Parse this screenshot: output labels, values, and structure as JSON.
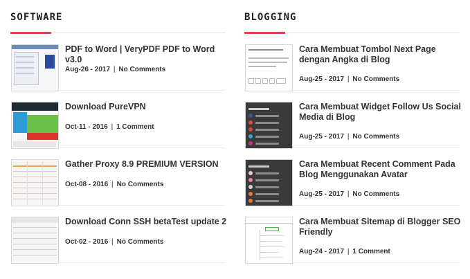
{
  "sections": {
    "software": {
      "title": "SOFTWARE",
      "posts": [
        {
          "title": "PDF to Word | VeryPDF PDF to Word v3.0",
          "date": "Aug-26 - 2017",
          "comments": "No Comments"
        },
        {
          "title": "Download PureVPN",
          "date": "Oct-11 - 2016",
          "comments": "1 Comment"
        },
        {
          "title": "Gather Proxy 8.9 PREMIUM VERSION",
          "date": "Oct-08 - 2016",
          "comments": "No Comments"
        },
        {
          "title": "Download Conn SSH betaTest update 2",
          "date": "Oct-02 - 2016",
          "comments": "No Comments"
        }
      ]
    },
    "blogging": {
      "title": "BLOGGING",
      "posts": [
        {
          "title": "Cara Membuat Tombol Next Page dengan Angka di Blog",
          "date": "Aug-25 - 2017",
          "comments": "No Comments"
        },
        {
          "title": "Cara Membuat Widget Follow Us Social Media di Blog",
          "date": "Aug-25 - 2017",
          "comments": "No Comments"
        },
        {
          "title": "Cara Membuat Recent Comment Pada Blog Menggunakan Avatar",
          "date": "Aug-25 - 2017",
          "comments": "No Comments"
        },
        {
          "title": "Cara Membuat Sitemap di Blogger SEO Friendly",
          "date": "Aug-24 - 2017",
          "comments": "1 Comment"
        }
      ]
    }
  },
  "meta_separator": "|",
  "colors": {
    "accent": "#e8414d",
    "text": "#333333",
    "divider": "#ececec"
  }
}
